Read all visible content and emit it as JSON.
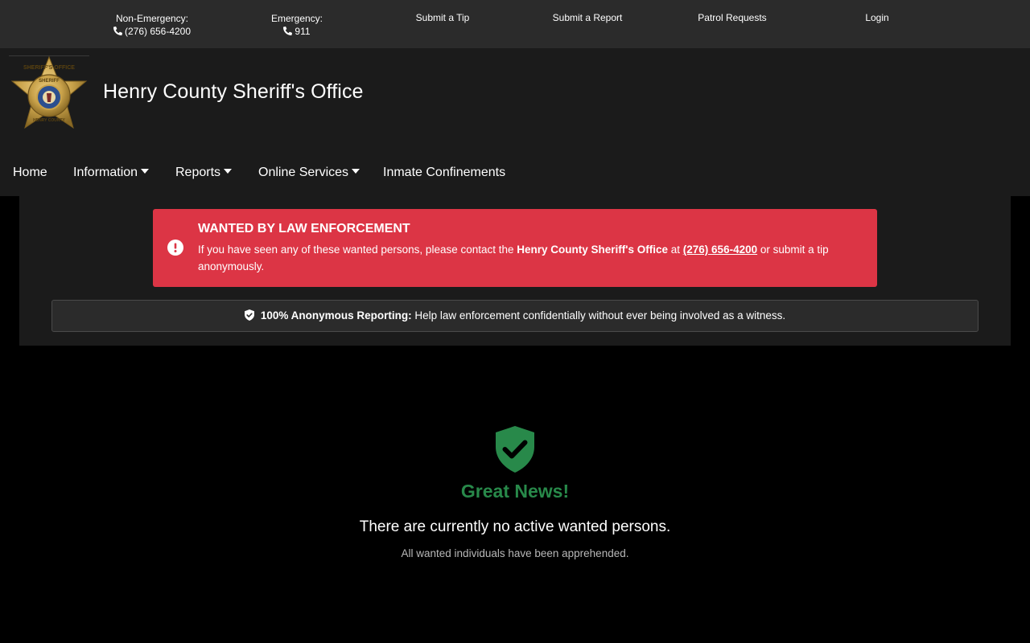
{
  "topbar": {
    "non_emergency_label": "Non-Emergency:",
    "non_emergency_phone": "(276) 656-4200",
    "emergency_label": "Emergency:",
    "emergency_phone": "911",
    "submit_tip": "Submit a Tip",
    "submit_report": "Submit a Report",
    "patrol_requests": "Patrol Requests",
    "login": "Login"
  },
  "header": {
    "title": "Henry County Sheriff's Office",
    "logo_icon": "sheriff-badge-icon",
    "logo_text_top": "SHERIFF'S OFFICE",
    "logo_text_mid": "SHERIFF",
    "logo_text_bottom": "HENRY COUNTY"
  },
  "nav": {
    "items": [
      {
        "label": "Home",
        "dropdown": false
      },
      {
        "label": "Information",
        "dropdown": true
      },
      {
        "label": "Reports",
        "dropdown": true
      },
      {
        "label": "Online Services",
        "dropdown": true
      },
      {
        "label": "Inmate Confinements",
        "dropdown": false
      }
    ]
  },
  "alert": {
    "title": "WANTED BY LAW ENFORCEMENT",
    "body_prefix": "If you have seen any of these wanted persons, please contact the ",
    "agency": "Henry County Sheriff's Office",
    "at": " at ",
    "phone": "(276) 656-4200",
    "body_suffix": " or submit a tip anonymously.",
    "icon": "exclamation-circle-icon"
  },
  "anonymous": {
    "strong": "100% Anonymous Reporting:",
    "text": " Help law enforcement confidentially without ever being involved as a witness.",
    "icon": "shield-check-icon"
  },
  "empty_state": {
    "icon": "shield-check-icon",
    "heading": "Great News!",
    "message": "There are currently no active wanted persons.",
    "submessage": "All wanted individuals have been apprehended."
  },
  "colors": {
    "topbar_bg": "#2b2b2b",
    "header_bg": "#1b1b1b",
    "page_bg": "#000000",
    "alert_red": "#dc3545",
    "success_green": "#28894a",
    "badge_gold": "#c9a24a"
  }
}
